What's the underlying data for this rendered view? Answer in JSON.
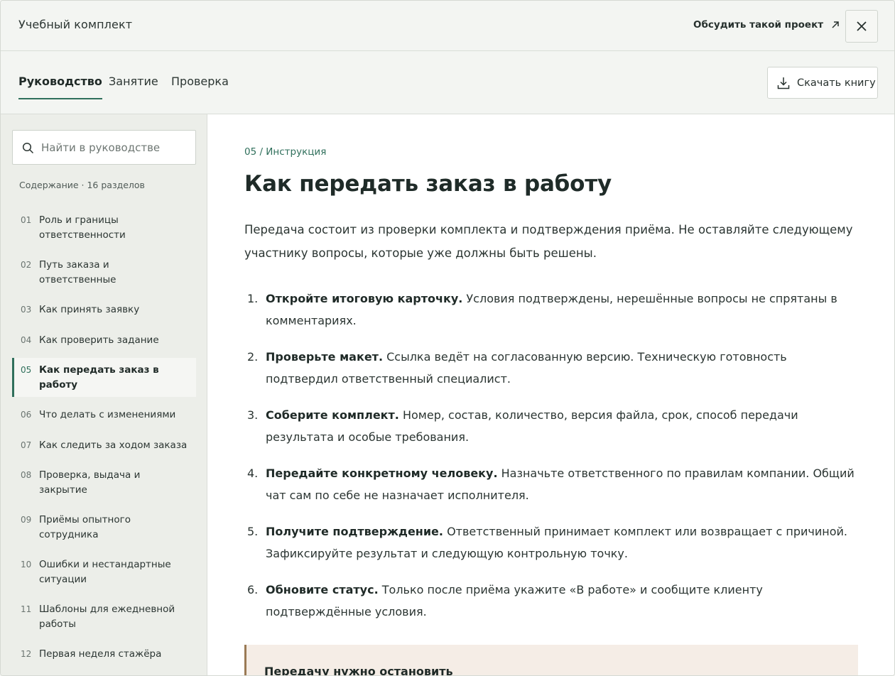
{
  "header": {
    "title": "Учебный комплект",
    "discuss_label": "Обсудить такой проект",
    "close_icon": "close-icon",
    "discuss_icon": "arrow-up-right-icon"
  },
  "tabs": [
    {
      "label": "Руководство",
      "active": true
    },
    {
      "label": "Занятие",
      "active": false
    },
    {
      "label": "Проверка",
      "active": false
    }
  ],
  "download": {
    "label": "Скачать книгу",
    "icon": "download-icon"
  },
  "sidebar": {
    "search_placeholder": "Найти в руководстве",
    "caption": "Содержание · 16 разделов",
    "items": [
      {
        "num": "01",
        "label": "Роль и границы ответственности"
      },
      {
        "num": "02",
        "label": "Путь заказа и ответственные"
      },
      {
        "num": "03",
        "label": "Как принять заявку"
      },
      {
        "num": "04",
        "label": "Как проверить задание"
      },
      {
        "num": "05",
        "label": "Как передать заказ в работу",
        "active": true
      },
      {
        "num": "06",
        "label": "Что делать с изменениями"
      },
      {
        "num": "07",
        "label": "Как следить за ходом заказа"
      },
      {
        "num": "08",
        "label": "Проверка, выдача и закрытие"
      },
      {
        "num": "09",
        "label": "Приёмы опытного сотрудника"
      },
      {
        "num": "10",
        "label": "Ошибки и нестандартные ситуации"
      },
      {
        "num": "11",
        "label": "Шаблоны для ежедневной работы"
      },
      {
        "num": "12",
        "label": "Первая неделя стажёра"
      }
    ]
  },
  "main": {
    "breadcrumb": "05 / Инструкция",
    "title": "Как передать заказ в работу",
    "lead": "Передача состоит из проверки комплекта и подтверждения приёма. Не оставляйте следующему участнику вопросы, которые уже должны быть решены.",
    "steps": [
      {
        "num": "1.",
        "bold": "Откройте итоговую карточку.",
        "text": " Условия подтверждены, нерешённые вопросы не спрятаны в комментариях."
      },
      {
        "num": "2.",
        "bold": "Проверьте макет.",
        "text": " Ссылка ведёт на согласованную версию. Техническую готовность подтвердил ответственный специалист."
      },
      {
        "num": "3.",
        "bold": "Соберите комплект.",
        "text": " Номер, состав, количество, версия файла, срок, способ передачи результата и особые требования."
      },
      {
        "num": "4.",
        "bold": "Передайте конкретному человеку.",
        "text": " Назначьте ответственного по правилам компании. Общий чат сам по себе не назначает исполнителя."
      },
      {
        "num": "5.",
        "bold": "Получите подтверждение.",
        "text": " Ответственный принимает комплект или возвращает с причиной. Зафиксируйте результат и следующую контрольную точку."
      },
      {
        "num": "6.",
        "bold": "Обновите статус.",
        "text": " Только после приёма укажите «В работе» и сообщите клиенту подтверждённые условия."
      }
    ],
    "callout_title": "Передачу нужно остановить"
  },
  "colors": {
    "accent": "#2f6f5b",
    "callout_bg": "#f5ede6",
    "callout_border": "#9a7a55"
  }
}
